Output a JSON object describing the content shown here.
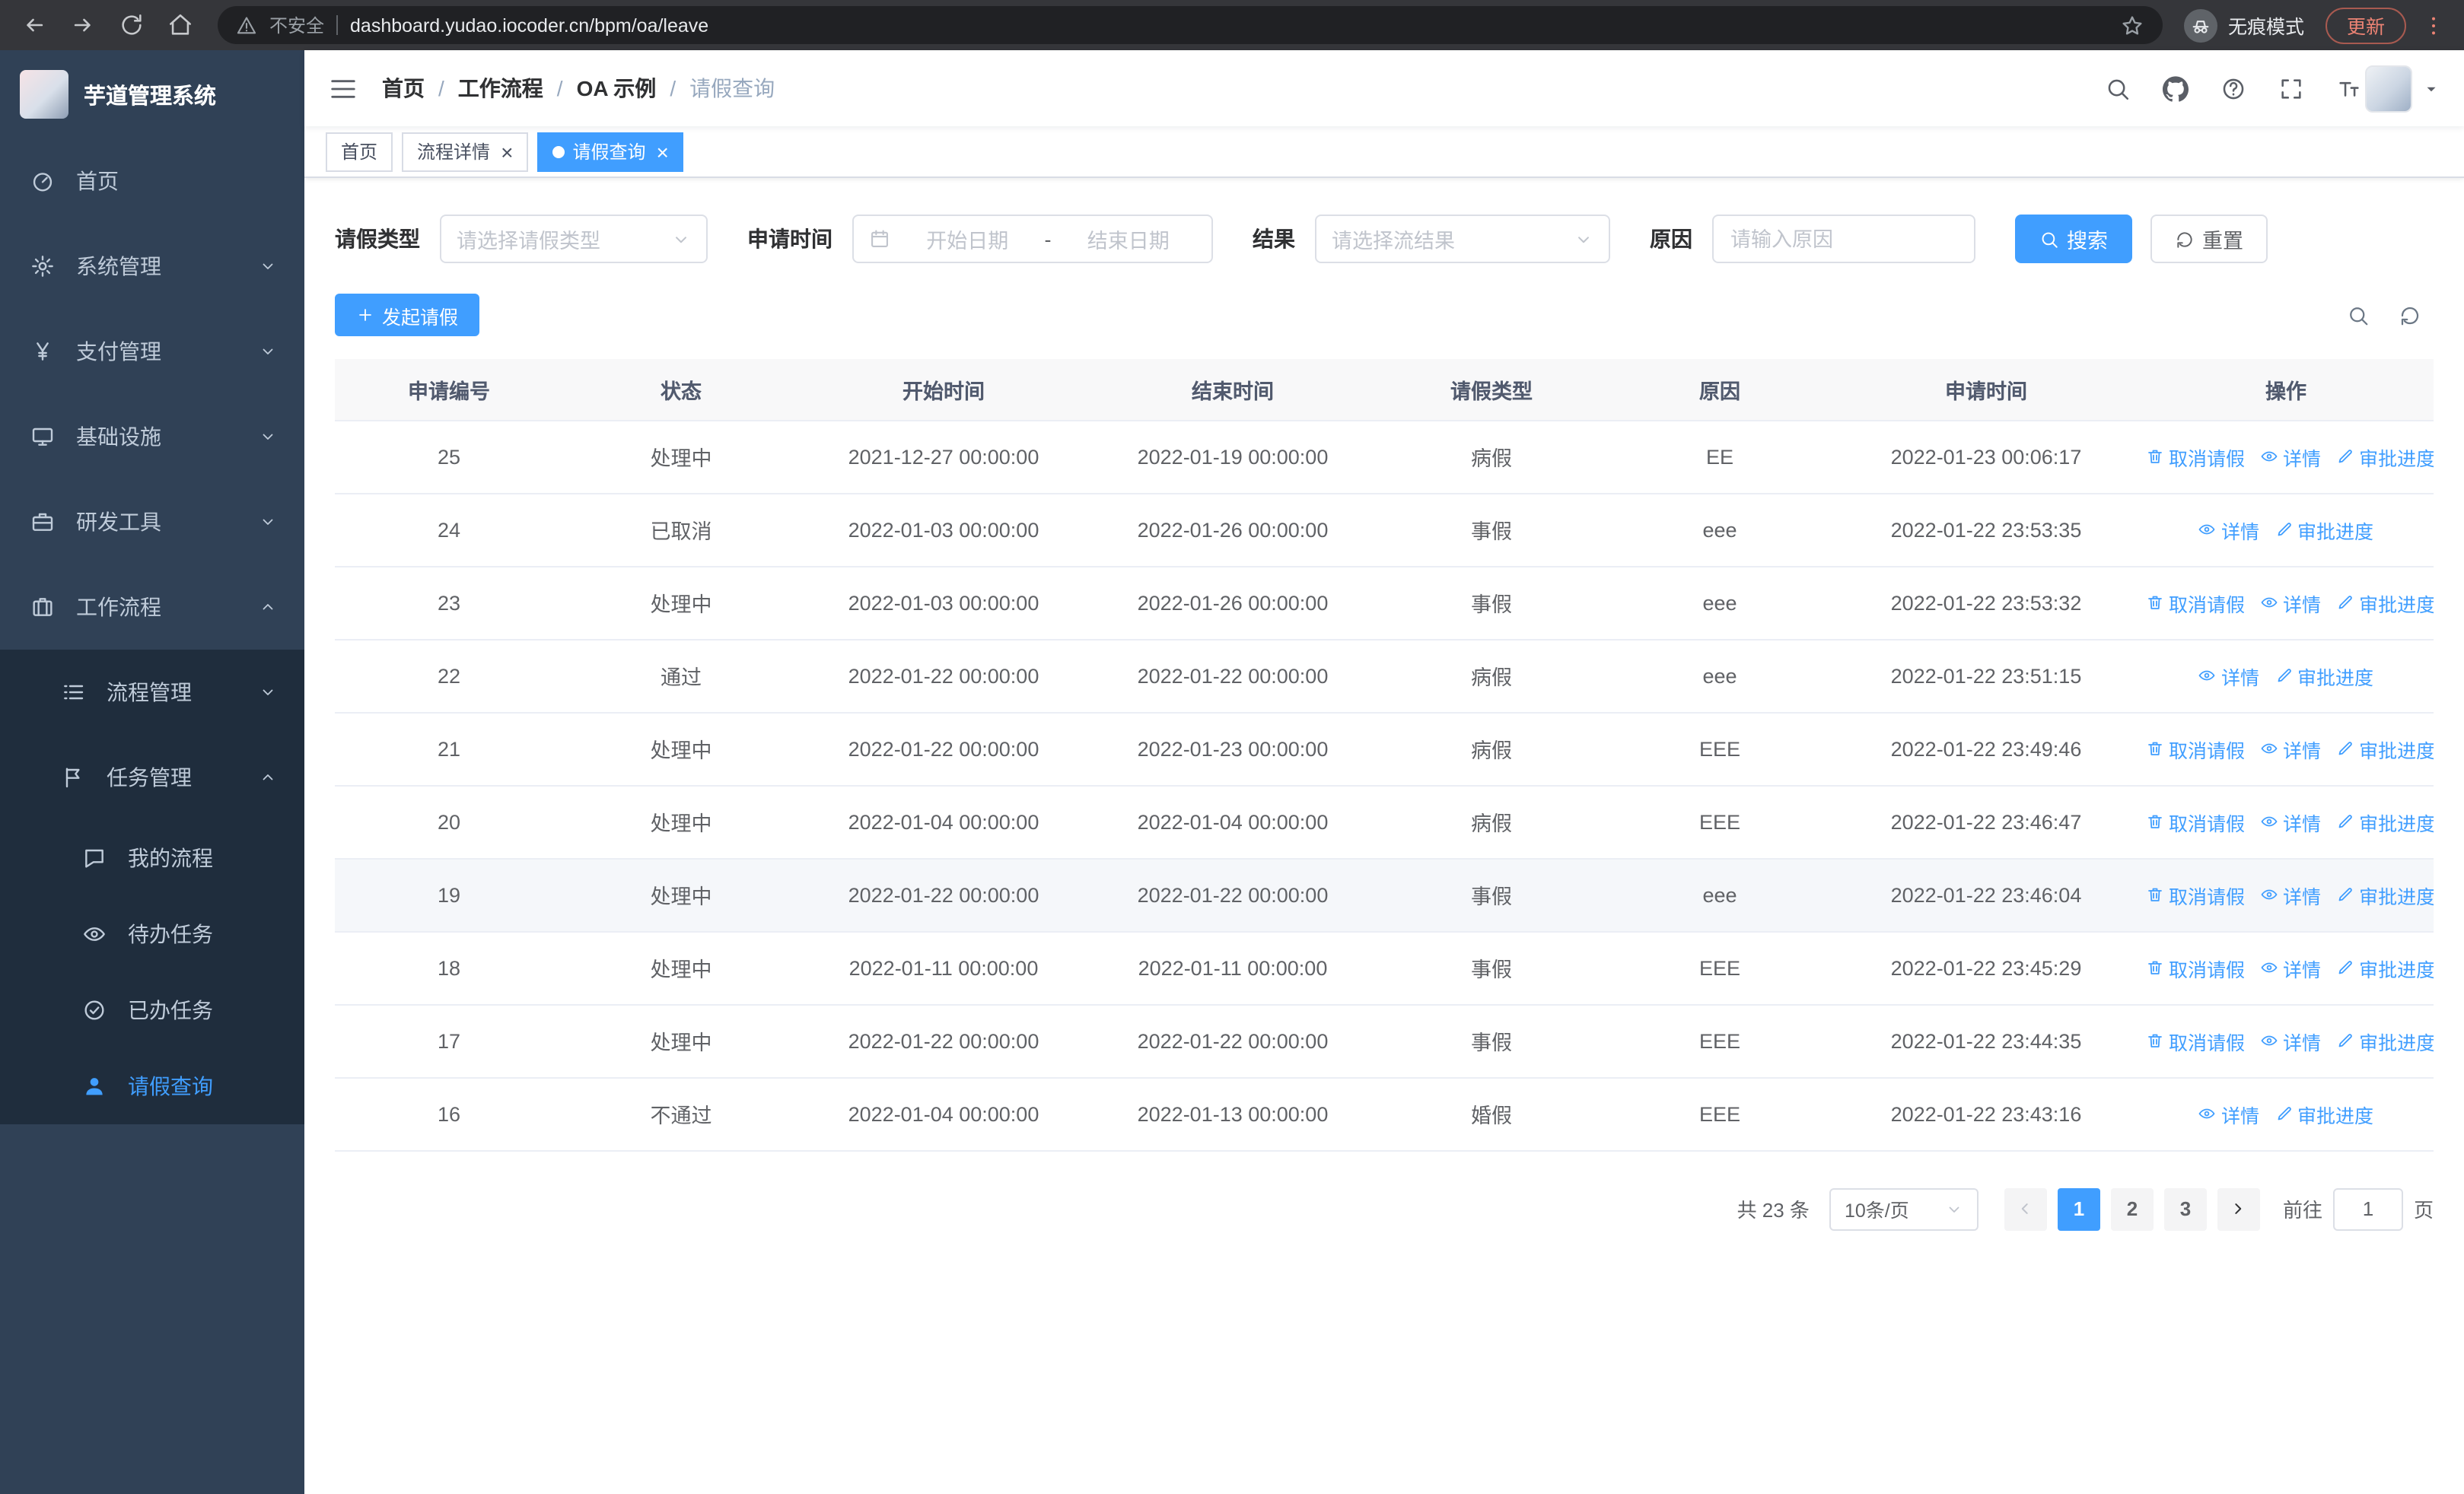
{
  "browser": {
    "nav_icons": [
      "back-icon",
      "forward-icon",
      "reload-icon",
      "home-icon"
    ],
    "warning_icon": "warning-icon",
    "security_label": "不安全",
    "url": "dashboard.yudao.iocoder.cn/bpm/oa/leave",
    "star_icon": "star-icon",
    "incognito_icon": "incognito-icon",
    "incognito_label": "无痕模式",
    "update_label": "更新",
    "menu_icon": "kebab-menu-icon"
  },
  "sidebar": {
    "logo_title": "芋道管理系统",
    "items": [
      {
        "label": "首页",
        "icon": "dashboard-icon",
        "level": 1
      },
      {
        "label": "系统管理",
        "icon": "gear-icon",
        "level": 1,
        "arrow": "down"
      },
      {
        "label": "支付管理",
        "icon": "yen-icon",
        "level": 1,
        "arrow": "down"
      },
      {
        "label": "基础设施",
        "icon": "monitor-icon",
        "level": 1,
        "arrow": "down"
      },
      {
        "label": "研发工具",
        "icon": "briefcase-icon",
        "level": 1,
        "arrow": "down"
      },
      {
        "label": "工作流程",
        "icon": "suitcase-icon",
        "level": 1,
        "arrow": "up"
      },
      {
        "label": "流程管理",
        "icon": "list-icon",
        "level": 2,
        "arrow": "down"
      },
      {
        "label": "任务管理",
        "icon": "flag-icon",
        "level": 2,
        "arrow": "up"
      },
      {
        "label": "我的流程",
        "icon": "chat-icon",
        "level": 3
      },
      {
        "label": "待办任务",
        "icon": "eye-icon",
        "level": 3
      },
      {
        "label": "已办任务",
        "icon": "check-circle-icon",
        "level": 3
      },
      {
        "label": "请假查询",
        "icon": "user-icon",
        "level": 3,
        "active": true
      }
    ]
  },
  "header": {
    "collapse_icon": "hamburger-icon",
    "breadcrumb": [
      "首页",
      "工作流程",
      "OA 示例",
      "请假查询"
    ],
    "icons": [
      "search-icon",
      "github-icon",
      "help-icon",
      "fullscreen-icon",
      "font-size-icon"
    ],
    "avatar_caret": "caret-down-icon"
  },
  "tabs": [
    {
      "label": "首页",
      "closable": false,
      "active": false
    },
    {
      "label": "流程详情",
      "closable": true,
      "active": false
    },
    {
      "label": "请假查询",
      "closable": true,
      "active": true
    }
  ],
  "filters": {
    "leave_type_label": "请假类型",
    "leave_type_placeholder": "请选择请假类型",
    "apply_time_label": "申请时间",
    "date_icon": "calendar-icon",
    "date_start_placeholder": "开始日期",
    "date_separator": "-",
    "date_end_placeholder": "结束日期",
    "result_label": "结果",
    "result_placeholder": "请选择流结果",
    "reason_label": "原因",
    "reason_placeholder": "请输入原因",
    "select_icon": "chevron-down-icon",
    "search_icon": "search-icon",
    "search_button": "搜索",
    "reset_icon": "refresh-icon",
    "reset_button": "重置"
  },
  "toolbar": {
    "create_icon": "plus-icon",
    "create_button": "发起请假",
    "icons": [
      "search-icon",
      "refresh-icon"
    ]
  },
  "table": {
    "columns": [
      "申请编号",
      "状态",
      "开始时间",
      "结束时间",
      "请假类型",
      "原因",
      "申请时间",
      "操作"
    ],
    "actions": {
      "cancel": {
        "label": "取消请假",
        "icon": "delete-icon"
      },
      "detail": {
        "label": "详情",
        "icon": "view-icon"
      },
      "progress": {
        "label": "审批进度",
        "icon": "edit-icon"
      }
    },
    "rows": [
      {
        "id": "25",
        "status": "处理中",
        "start": "2021-12-27 00:00:00",
        "end": "2022-01-19 00:00:00",
        "type": "病假",
        "reason": "EE",
        "applied": "2022-01-23 00:06:17",
        "cancellable": true
      },
      {
        "id": "24",
        "status": "已取消",
        "start": "2022-01-03 00:00:00",
        "end": "2022-01-26 00:00:00",
        "type": "事假",
        "reason": "eee",
        "applied": "2022-01-22 23:53:35",
        "cancellable": false
      },
      {
        "id": "23",
        "status": "处理中",
        "start": "2022-01-03 00:00:00",
        "end": "2022-01-26 00:00:00",
        "type": "事假",
        "reason": "eee",
        "applied": "2022-01-22 23:53:32",
        "cancellable": true
      },
      {
        "id": "22",
        "status": "通过",
        "start": "2022-01-22 00:00:00",
        "end": "2022-01-22 00:00:00",
        "type": "病假",
        "reason": "eee",
        "applied": "2022-01-22 23:51:15",
        "cancellable": false
      },
      {
        "id": "21",
        "status": "处理中",
        "start": "2022-01-22 00:00:00",
        "end": "2022-01-23 00:00:00",
        "type": "病假",
        "reason": "EEE",
        "applied": "2022-01-22 23:49:46",
        "cancellable": true
      },
      {
        "id": "20",
        "status": "处理中",
        "start": "2022-01-04 00:00:00",
        "end": "2022-01-04 00:00:00",
        "type": "病假",
        "reason": "EEE",
        "applied": "2022-01-22 23:46:47",
        "cancellable": true
      },
      {
        "id": "19",
        "status": "处理中",
        "start": "2022-01-22 00:00:00",
        "end": "2022-01-22 00:00:00",
        "type": "事假",
        "reason": "eee",
        "applied": "2022-01-22 23:46:04",
        "cancellable": true,
        "hover": true
      },
      {
        "id": "18",
        "status": "处理中",
        "start": "2022-01-11 00:00:00",
        "end": "2022-01-11 00:00:00",
        "type": "事假",
        "reason": "EEE",
        "applied": "2022-01-22 23:45:29",
        "cancellable": true
      },
      {
        "id": "17",
        "status": "处理中",
        "start": "2022-01-22 00:00:00",
        "end": "2022-01-22 00:00:00",
        "type": "事假",
        "reason": "EEE",
        "applied": "2022-01-22 23:44:35",
        "cancellable": true
      },
      {
        "id": "16",
        "status": "不通过",
        "start": "2022-01-04 00:00:00",
        "end": "2022-01-13 00:00:00",
        "type": "婚假",
        "reason": "EEE",
        "applied": "2022-01-22 23:43:16",
        "cancellable": false
      }
    ]
  },
  "pagination": {
    "total_text": "共 23 条",
    "page_size_text": "10条/页",
    "size_caret": "chevron-down-icon",
    "prev_icon": "chevron-left-icon",
    "next_icon": "chevron-right-icon",
    "pages": [
      "1",
      "2",
      "3"
    ],
    "active_page": "1",
    "goto_label": "前往",
    "goto_value": "1",
    "goto_suffix": "页"
  },
  "colors": {
    "primary": "#409eff",
    "sidebar_bg": "#304156",
    "sidebar_sub_bg": "#1f2d3d",
    "chrome_bg": "#35363a"
  }
}
